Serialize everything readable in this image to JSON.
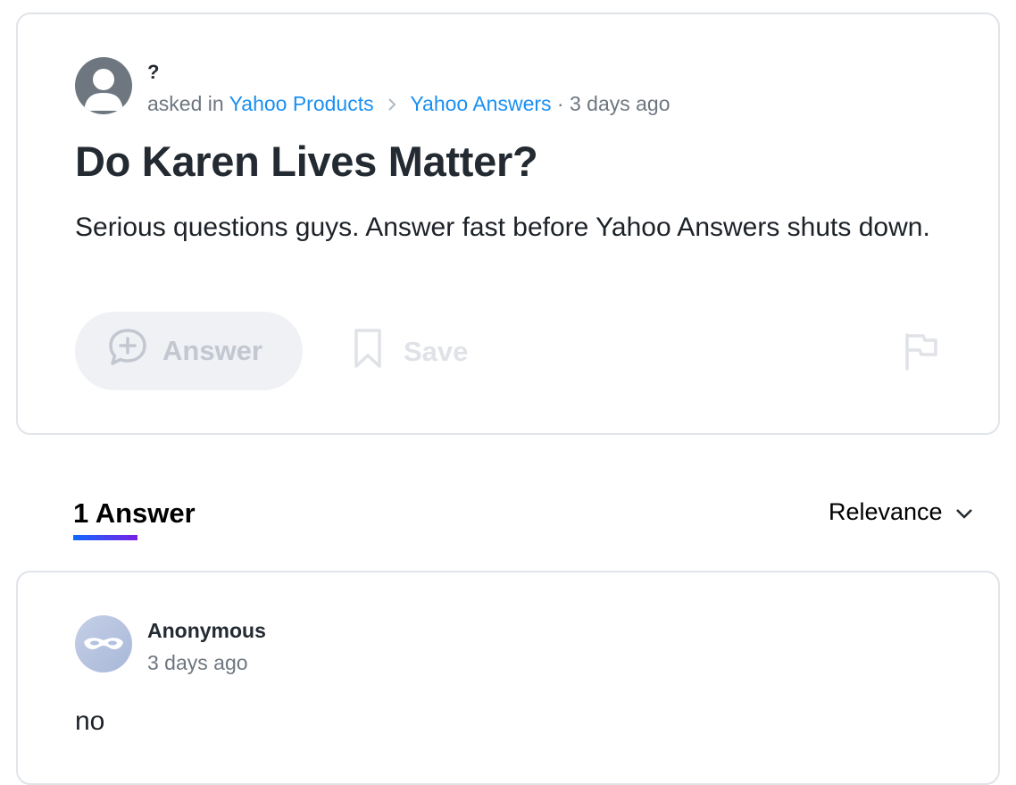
{
  "question": {
    "author": "?",
    "asked_in_prefix": "asked in",
    "category": "Yahoo Products",
    "subcategory": "Yahoo Answers",
    "time": "3 days ago",
    "title": "Do Karen Lives Matter?",
    "body": "Serious questions guys. Answer fast before Yahoo Answers shuts down.",
    "actions": {
      "answer_label": "Answer",
      "save_label": "Save"
    }
  },
  "answers_section": {
    "count_label": "1 Answer",
    "sort_label": "Relevance"
  },
  "answers": [
    {
      "author": "Anonymous",
      "time": "3 days ago",
      "body": "no"
    }
  ],
  "colors": {
    "link": "#1a8ff2",
    "underline_start": "#0f69ff",
    "underline_end": "#7b1fe4"
  },
  "icons": [
    "user-avatar-icon",
    "chevron-right-icon",
    "add-comment-icon",
    "bookmark-icon",
    "flag-icon",
    "chevron-down-icon",
    "anonymous-mask-icon"
  ]
}
